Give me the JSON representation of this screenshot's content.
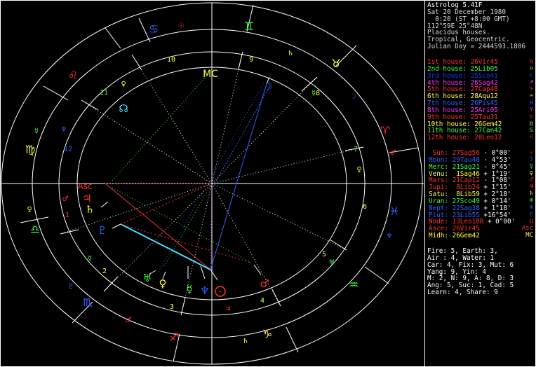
{
  "header": {
    "title": "Astrolog 5.41F",
    "lines": [
      "Sat 20 December 1980",
      "  0:20 (ST +8:00 GMT)",
      "112°59E 25°48N",
      "Placidus houses.",
      "Tropical, Geocentric.",
      "Julian Day = 2444593.1806"
    ]
  },
  "houses": [
    {
      "label": "1st house:",
      "value": "26Vir45",
      "color": "#ff3030",
      "symbol": "♍"
    },
    {
      "label": "2nd house:",
      "value": "25Lib05",
      "color": "#40ff40",
      "symbol": "♎"
    },
    {
      "label": "3rd house:",
      "value": "25Sco41",
      "color": "#2030ff",
      "symbol": "♏"
    },
    {
      "label": "4th house:",
      "value": "26Sag42",
      "color": "#ff30ff",
      "symbol": "♐"
    },
    {
      "label": "5th house:",
      "value": "27Cap48",
      "color": "#ff3030",
      "symbol": "♑"
    },
    {
      "label": "6th house:",
      "value": "28Aqu12",
      "color": "#ffff40",
      "symbol": "♒"
    },
    {
      "label": "7th house:",
      "value": "26Pis45",
      "color": "#3060ff",
      "symbol": "♓"
    },
    {
      "label": "8th house:",
      "value": "25Ari05",
      "color": "#ff30ff",
      "symbol": "♈"
    },
    {
      "label": "9th house:",
      "value": "25Tau31",
      "color": "#ff3030",
      "symbol": "♉"
    },
    {
      "label": "10th house:",
      "value": "26Gem42",
      "color": "#ffff40",
      "symbol": "♊"
    },
    {
      "label": "11th house:",
      "value": "27Can42",
      "color": "#40ff40",
      "symbol": "♋"
    },
    {
      "label": "12th house:",
      "value": "28Leo12",
      "color": "#ff3030",
      "symbol": "♌"
    }
  ],
  "planets": [
    {
      "name": "Sun:",
      "sign": "27Sag56",
      "extra": " - 0°00'",
      "color": "#ff3030",
      "symbol": "☉"
    },
    {
      "name": "Moon:",
      "sign": "29Tau48",
      "extra": " - 4°53'",
      "color": "#3060ff",
      "symbol": "☽"
    },
    {
      "name": "Merc:",
      "sign": "21Sag21",
      "extra": " - 0°45'",
      "color": "#40ff40",
      "symbol": "☿"
    },
    {
      "name": "Venu:",
      "sign": " 1Sag46",
      "extra": " + 1°19'",
      "color": "#ffff40",
      "symbol": "♀"
    },
    {
      "name": "Mars:",
      "sign": "21Cap12",
      "extra": " - 1°08'",
      "color": "#ff3030",
      "symbol": "♂"
    },
    {
      "name": "Jupi:",
      "sign": " 8Lib24",
      "extra": " + 1°15'",
      "color": "#ff3030",
      "symbol": "♃"
    },
    {
      "name": "Satu:",
      "sign": " 8Lib59",
      "extra": " + 2°18'",
      "color": "#ffff40",
      "symbol": "♄"
    },
    {
      "name": "Uran:",
      "sign": "27Sco49",
      "extra": " + 0°14'",
      "color": "#40ff40",
      "symbol": "♅"
    },
    {
      "name": "Nept:",
      "sign": "22Sag38",
      "extra": " + 1°18'",
      "color": "#3060ff",
      "symbol": "♆"
    },
    {
      "name": "Plut:",
      "sign": "23Lib55",
      "extra": " +16°54'",
      "color": "#3060ff",
      "symbol": "♇"
    },
    {
      "name": "Node:",
      "sign": "13Leo18R",
      "extra": " + 0°00'",
      "color": "#ff3030",
      "symbol": "☊"
    },
    {
      "name": "Asce:",
      "sign": "26Vir45",
      "extra": "",
      "color": "#ff3030",
      "symbol": "Asc"
    },
    {
      "name": "Midh:",
      "sign": "26Gem42",
      "extra": "",
      "color": "#ffff40",
      "symbol": "MC"
    }
  ],
  "stats": [
    "Fire: 5, Earth: 3,",
    "Air : 4, Water: 1",
    "Car: 4, Fix: 3, Mut: 6",
    "Yang: 9, Yin: 4",
    "M: 2, N: 9, A: 8, D: 3",
    "Ang: 5, Suc: 1, Cad: 5",
    "Learn: 4, Share: 9"
  ],
  "wheel": {
    "house_numbers": [
      "1",
      "2",
      "3",
      "4",
      "5",
      "6",
      "7",
      "8",
      "9",
      "10",
      "11",
      "12"
    ],
    "mc_label": "MC",
    "asc_label": "Asc",
    "signs": [
      {
        "name": "leo-icon",
        "glyph": "♌",
        "color": "#ff3030"
      },
      {
        "name": "cancer-icon",
        "glyph": "♋",
        "color": "#3060ff"
      },
      {
        "name": "gemini-icon",
        "glyph": "♊",
        "color": "#40ff40"
      },
      {
        "name": "taurus-icon",
        "glyph": "♉",
        "color": "#ffff40"
      },
      {
        "name": "aries-icon",
        "glyph": "♈",
        "color": "#ff3030"
      },
      {
        "name": "pisces-icon",
        "glyph": "♓",
        "color": "#3060ff"
      },
      {
        "name": "aquarius-icon",
        "glyph": "♒",
        "color": "#40ff40"
      },
      {
        "name": "capricorn-icon",
        "glyph": "♑",
        "color": "#ffff40"
      },
      {
        "name": "sagittarius-icon",
        "glyph": "♐",
        "color": "#ff3030"
      },
      {
        "name": "scorpio-icon",
        "glyph": "♏",
        "color": "#3060ff"
      },
      {
        "name": "libra-icon",
        "glyph": "♎",
        "color": "#40ff40"
      },
      {
        "name": "virgo-icon",
        "glyph": "♍",
        "color": "#ffff40"
      }
    ],
    "ruler_glyphs": [
      "☉",
      "☽",
      "☿",
      "♂",
      "♄",
      "♃",
      "♅",
      "♆",
      "♇",
      "♀"
    ]
  }
}
